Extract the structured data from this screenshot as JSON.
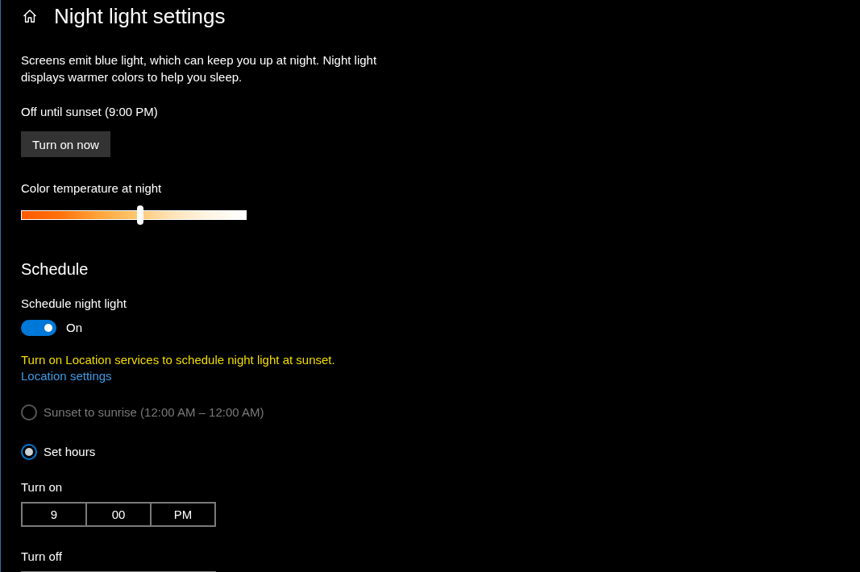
{
  "header": {
    "title": "Night light settings"
  },
  "description": "Screens emit blue light, which can keep you up at night. Night light displays warmer colors to help you sleep.",
  "status": "Off until sunset (9:00 PM)",
  "turn_on_button": {
    "label": "Turn on now"
  },
  "color_temperature": {
    "label": "Color temperature at night",
    "level": 0.53
  },
  "schedule": {
    "heading": "Schedule",
    "toggle": {
      "label": "Schedule night light",
      "on": true,
      "state_text": "On"
    },
    "warning": "Turn on Location services to schedule night light at sunset.",
    "link": "Location settings",
    "options": [
      {
        "label": "Sunset to sunrise (12:00 AM – 12:00 AM)",
        "selected": false,
        "disabled": true
      },
      {
        "label": "Set hours",
        "selected": true,
        "disabled": false
      }
    ],
    "times": [
      {
        "label": "Turn on",
        "fields": [
          "9",
          "00",
          "PM"
        ]
      },
      {
        "label": "Turn off"
      }
    ]
  }
}
